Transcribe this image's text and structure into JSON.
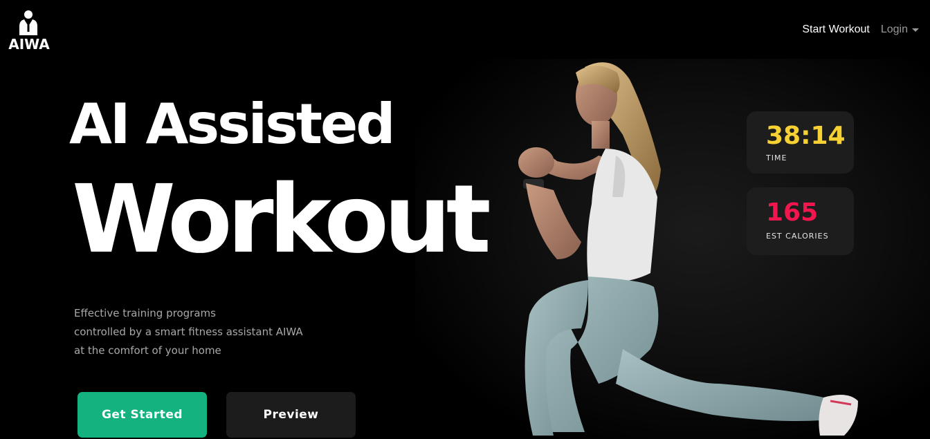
{
  "brand": {
    "name": "AIWA",
    "logo_icon": "person-icon"
  },
  "nav": {
    "start_workout": "Start Workout",
    "login": "Login"
  },
  "hero": {
    "title_line1": "AI Assisted",
    "title_line2": "Workout",
    "description": [
      "Effective training programs",
      "controlled by a smart fitness assistant AIWA",
      "at the comfort of your home"
    ],
    "primary_button": "Get Started",
    "secondary_button": "Preview"
  },
  "stats": {
    "time": {
      "value": "38:14",
      "label": "TIME",
      "color": "#f7d133"
    },
    "calories": {
      "value": "165",
      "label": "EST CALORIES",
      "color": "#f2164f"
    }
  },
  "colors": {
    "accent": "#13b27f",
    "background": "#000000",
    "card": "#1d1d1d"
  }
}
